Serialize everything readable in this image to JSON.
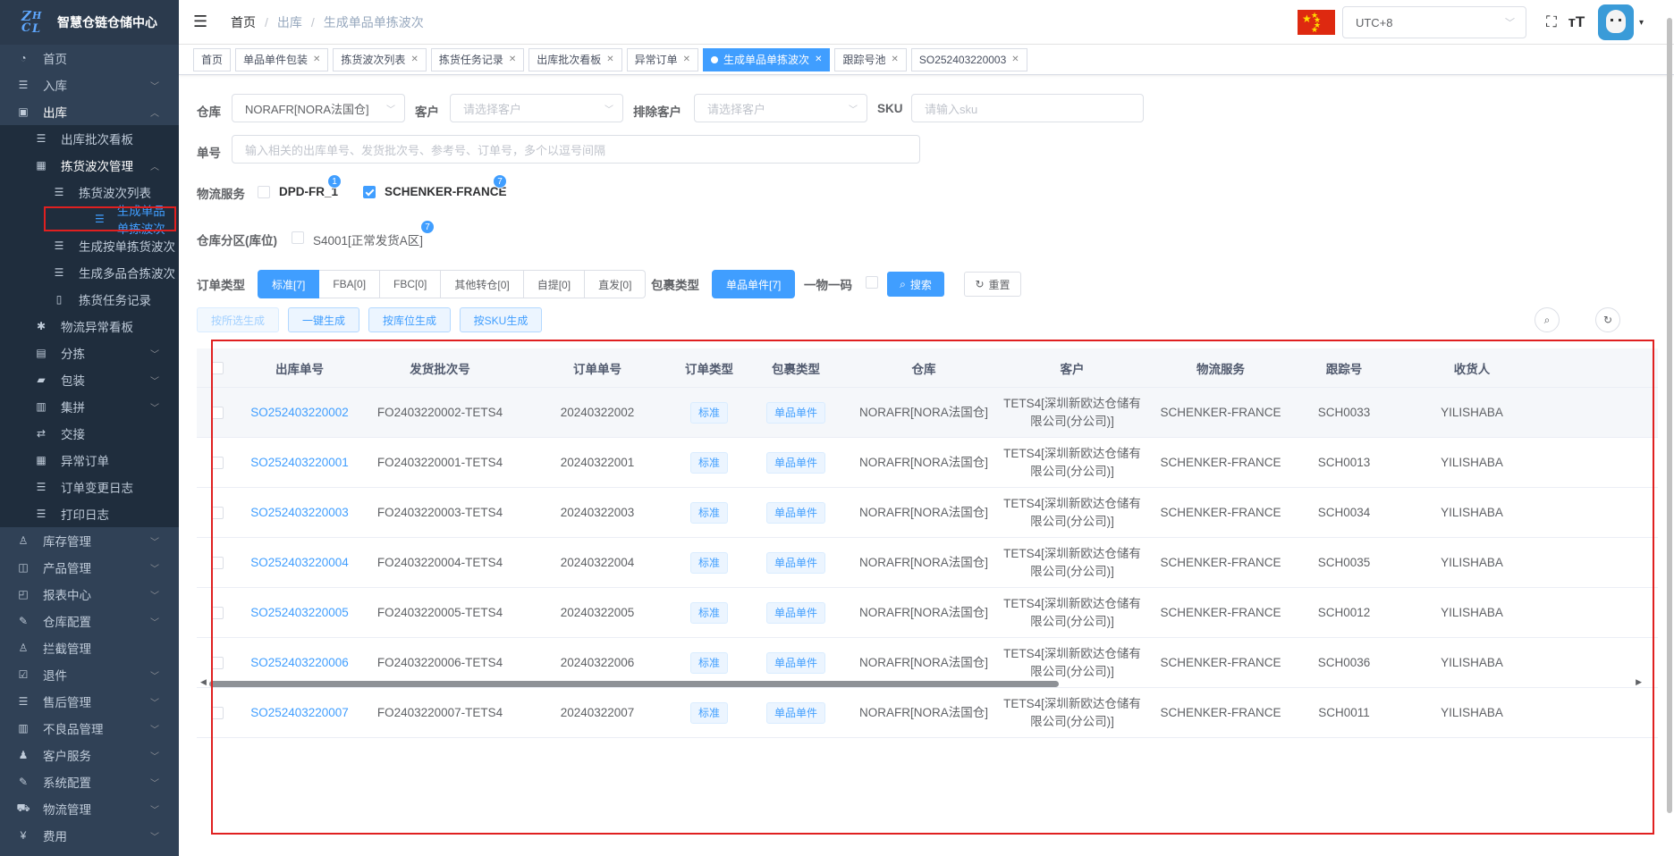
{
  "app": {
    "title": "智慧仓链仓储中心"
  },
  "sidebar": {
    "items": [
      {
        "label": "首页",
        "icon": "dashboard-icon"
      },
      {
        "label": "入库",
        "icon": "list-icon"
      },
      {
        "label": "出库",
        "icon": "box-icon"
      },
      {
        "label": "出库批次看板",
        "icon": "list-icon"
      },
      {
        "label": "拣货波次管理",
        "icon": "grid-icon"
      },
      {
        "label": "拣货波次列表",
        "icon": "list-icon"
      },
      {
        "label": "生成单品单拣波次",
        "icon": "list-icon"
      },
      {
        "label": "生成按单拣货波次",
        "icon": "list-icon"
      },
      {
        "label": "生成多品合拣波次",
        "icon": "list-icon"
      },
      {
        "label": "拣货任务记录",
        "icon": "book-icon"
      },
      {
        "label": "物流异常看板",
        "icon": "bug-icon"
      },
      {
        "label": "分拣",
        "icon": "doc-icon"
      },
      {
        "label": "包装",
        "icon": "lock-icon"
      },
      {
        "label": "集拼",
        "icon": "print-icon"
      },
      {
        "label": "交接",
        "icon": "exchange-icon"
      },
      {
        "label": "异常订单",
        "icon": "grid-icon"
      },
      {
        "label": "订单变更日志",
        "icon": "list-icon"
      },
      {
        "label": "打印日志",
        "icon": "list-icon"
      },
      {
        "label": "库存管理",
        "icon": "person-icon"
      },
      {
        "label": "产品管理",
        "icon": "bag-icon"
      },
      {
        "label": "报表中心",
        "icon": "chart-icon"
      },
      {
        "label": "仓库配置",
        "icon": "edit-icon"
      },
      {
        "label": "拦截管理",
        "icon": "person-icon"
      },
      {
        "label": "退件",
        "icon": "check-icon"
      },
      {
        "label": "售后管理",
        "icon": "list-icon"
      },
      {
        "label": "不良品管理",
        "icon": "print-icon"
      },
      {
        "label": "客户服务",
        "icon": "people-icon"
      },
      {
        "label": "系统配置",
        "icon": "edit-icon"
      },
      {
        "label": "物流管理",
        "icon": "truck-icon"
      },
      {
        "label": "费用",
        "icon": "yen-icon"
      }
    ]
  },
  "header": {
    "breadcrumb": [
      "首页",
      "出库",
      "生成单品单拣波次"
    ],
    "timezone": "UTC+8"
  },
  "tags": [
    {
      "label": "首页",
      "closable": false
    },
    {
      "label": "单品单件包装",
      "closable": true
    },
    {
      "label": "拣货波次列表",
      "closable": true
    },
    {
      "label": "拣货任务记录",
      "closable": true
    },
    {
      "label": "出库批次看板",
      "closable": true
    },
    {
      "label": "异常订单",
      "closable": true
    },
    {
      "label": "生成单品单拣波次",
      "closable": true,
      "active": true
    },
    {
      "label": "跟踪号池",
      "closable": true
    },
    {
      "label": "SO252403220003",
      "closable": true
    }
  ],
  "filters": {
    "warehouse_label": "仓库",
    "warehouse_value": "NORAFR[NORA法国仓]",
    "customer_label": "客户",
    "customer_placeholder": "请选择客户",
    "exclude_label": "排除客户",
    "exclude_placeholder": "请选择客户",
    "sku_label": "SKU",
    "sku_placeholder": "请输入sku",
    "order_no_label": "单号",
    "order_no_placeholder": "输入相关的出库单号、发货批次号、参考号、订单号，多个以逗号间隔",
    "logistics_label": "物流服务",
    "logistics_options": [
      {
        "label": "DPD-FR_1",
        "checked": false,
        "count": "1"
      },
      {
        "label": "SCHENKER-FRANCE",
        "checked": true,
        "count": "7"
      }
    ],
    "zone_label": "仓库分区(库位)",
    "zone_option": {
      "label": "S4001[正常发货A区]",
      "checked": false,
      "count": "7"
    },
    "order_type_label": "订单类型",
    "order_types": [
      "标准[7]",
      "FBA[0]",
      "FBC[0]",
      "其他转仓[0]",
      "自提[0]",
      "直发[0]"
    ],
    "package_type_label": "包裹类型",
    "package_type": "单品单件[7]",
    "one_code_label": "一物一码",
    "search_label": "搜索",
    "reset_label": "重置"
  },
  "actions": {
    "gen_selected": "按所选生成",
    "gen_one_click": "一键生成",
    "gen_by_location": "按库位生成",
    "gen_by_sku": "按SKU生成"
  },
  "table": {
    "columns": [
      "出库单号",
      "发货批次号",
      "订单单号",
      "订单类型",
      "包裹类型",
      "仓库",
      "客户",
      "物流服务",
      "跟踪号",
      "收货人"
    ],
    "rows": [
      {
        "outbound": "SO252403220002",
        "batch": "FO2403220002-TETS4",
        "order": "20240322002",
        "otype": "标准",
        "ptype": "单品单件",
        "warehouse": "NORAFR[NORA法国仓]",
        "customer1": "TETS4[深圳新欧达仓储有",
        "customer2": "限公司(分公司)]",
        "logistics": "SCHENKER-FRANCE",
        "tracking": "SCH0033",
        "receiver": "YILISHABA"
      },
      {
        "outbound": "SO252403220001",
        "batch": "FO2403220001-TETS4",
        "order": "20240322001",
        "otype": "标准",
        "ptype": "单品单件",
        "warehouse": "NORAFR[NORA法国仓]",
        "customer1": "TETS4[深圳新欧达仓储有",
        "customer2": "限公司(分公司)]",
        "logistics": "SCHENKER-FRANCE",
        "tracking": "SCH0013",
        "receiver": "YILISHABA"
      },
      {
        "outbound": "SO252403220003",
        "batch": "FO2403220003-TETS4",
        "order": "20240322003",
        "otype": "标准",
        "ptype": "单品单件",
        "warehouse": "NORAFR[NORA法国仓]",
        "customer1": "TETS4[深圳新欧达仓储有",
        "customer2": "限公司(分公司)]",
        "logistics": "SCHENKER-FRANCE",
        "tracking": "SCH0034",
        "receiver": "YILISHABA"
      },
      {
        "outbound": "SO252403220004",
        "batch": "FO2403220004-TETS4",
        "order": "20240322004",
        "otype": "标准",
        "ptype": "单品单件",
        "warehouse": "NORAFR[NORA法国仓]",
        "customer1": "TETS4[深圳新欧达仓储有",
        "customer2": "限公司(分公司)]",
        "logistics": "SCHENKER-FRANCE",
        "tracking": "SCH0035",
        "receiver": "YILISHABA"
      },
      {
        "outbound": "SO252403220005",
        "batch": "FO2403220005-TETS4",
        "order": "20240322005",
        "otype": "标准",
        "ptype": "单品单件",
        "warehouse": "NORAFR[NORA法国仓]",
        "customer1": "TETS4[深圳新欧达仓储有",
        "customer2": "限公司(分公司)]",
        "logistics": "SCHENKER-FRANCE",
        "tracking": "SCH0012",
        "receiver": "YILISHABA"
      },
      {
        "outbound": "SO252403220006",
        "batch": "FO2403220006-TETS4",
        "order": "20240322006",
        "otype": "标准",
        "ptype": "单品单件",
        "warehouse": "NORAFR[NORA法国仓]",
        "customer1": "TETS4[深圳新欧达仓储有",
        "customer2": "限公司(分公司)]",
        "logistics": "SCHENKER-FRANCE",
        "tracking": "SCH0036",
        "receiver": "YILISHABA"
      },
      {
        "outbound": "SO252403220007",
        "batch": "FO2403220007-TETS4",
        "order": "20240322007",
        "otype": "标准",
        "ptype": "单品单件",
        "warehouse": "NORAFR[NORA法国仓]",
        "customer1": "TETS4[深圳新欧达仓储有",
        "customer2": "限公司(分公司)]",
        "logistics": "SCHENKER-FRANCE",
        "tracking": "SCH0011",
        "receiver": "YILISHABA"
      }
    ]
  },
  "colors": {
    "accent": "#409eff",
    "sidebar": "#304156",
    "highlight": "#e02020"
  }
}
